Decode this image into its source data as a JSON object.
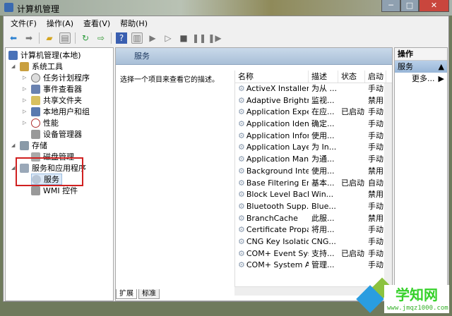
{
  "window": {
    "title": "计算机管理",
    "min": "─",
    "max": "□",
    "close": "✕"
  },
  "menu": [
    "文件(F)",
    "操作(A)",
    "查看(V)",
    "帮助(H)"
  ],
  "tree": {
    "root": "计算机管理(本地)",
    "system_tools": "系统工具",
    "system_children": [
      "任务计划程序",
      "事件查看器",
      "共享文件夹",
      "本地用户和组",
      "性能",
      "设备管理器"
    ],
    "storage": "存储",
    "disk": "磁盘管理",
    "services_apps": "服务和应用程序",
    "services": "服务",
    "wmi": "WMI 控件"
  },
  "center": {
    "header": "服务",
    "description": "选择一个项目来查看它的描述。",
    "columns": [
      "名称",
      "描述",
      "状态",
      "启动"
    ],
    "rows": [
      [
        "ActiveX Installer ...",
        "为从 ...",
        "",
        "手动"
      ],
      [
        "Adaptive Brightn...",
        "监视...",
        "",
        "禁用"
      ],
      [
        "Application Expe...",
        "在应...",
        "已启动",
        "手动"
      ],
      [
        "Application Iden...",
        "确定...",
        "",
        "手动"
      ],
      [
        "Application Infor...",
        "使用...",
        "",
        "手动"
      ],
      [
        "Application Laye...",
        "为 In...",
        "",
        "手动"
      ],
      [
        "Application Man...",
        "为通...",
        "",
        "手动"
      ],
      [
        "Background Inte...",
        "使用...",
        "",
        "禁用"
      ],
      [
        "Base Filtering En...",
        "基本...",
        "已启动",
        "自动"
      ],
      [
        "Block Level Back...",
        "Win...",
        "",
        "禁用"
      ],
      [
        "Bluetooth Supp...",
        "Blue...",
        "",
        "手动"
      ],
      [
        "BranchCache",
        "此服...",
        "",
        "禁用"
      ],
      [
        "Certificate Propa...",
        "将用...",
        "",
        "手动"
      ],
      [
        "CNG Key Isolation",
        "CNG...",
        "",
        "手动"
      ],
      [
        "COM+ Event Sys...",
        "支持...",
        "已启动",
        "手动"
      ],
      [
        "COM+ System A...",
        "管理...",
        "",
        "手动"
      ]
    ],
    "tabs": [
      "扩展",
      "标准"
    ]
  },
  "actions": {
    "header": "操作",
    "section": "服务",
    "more": "更多..."
  },
  "watermark": {
    "brand": "学知网",
    "url": "www.jmqz1000.com"
  }
}
